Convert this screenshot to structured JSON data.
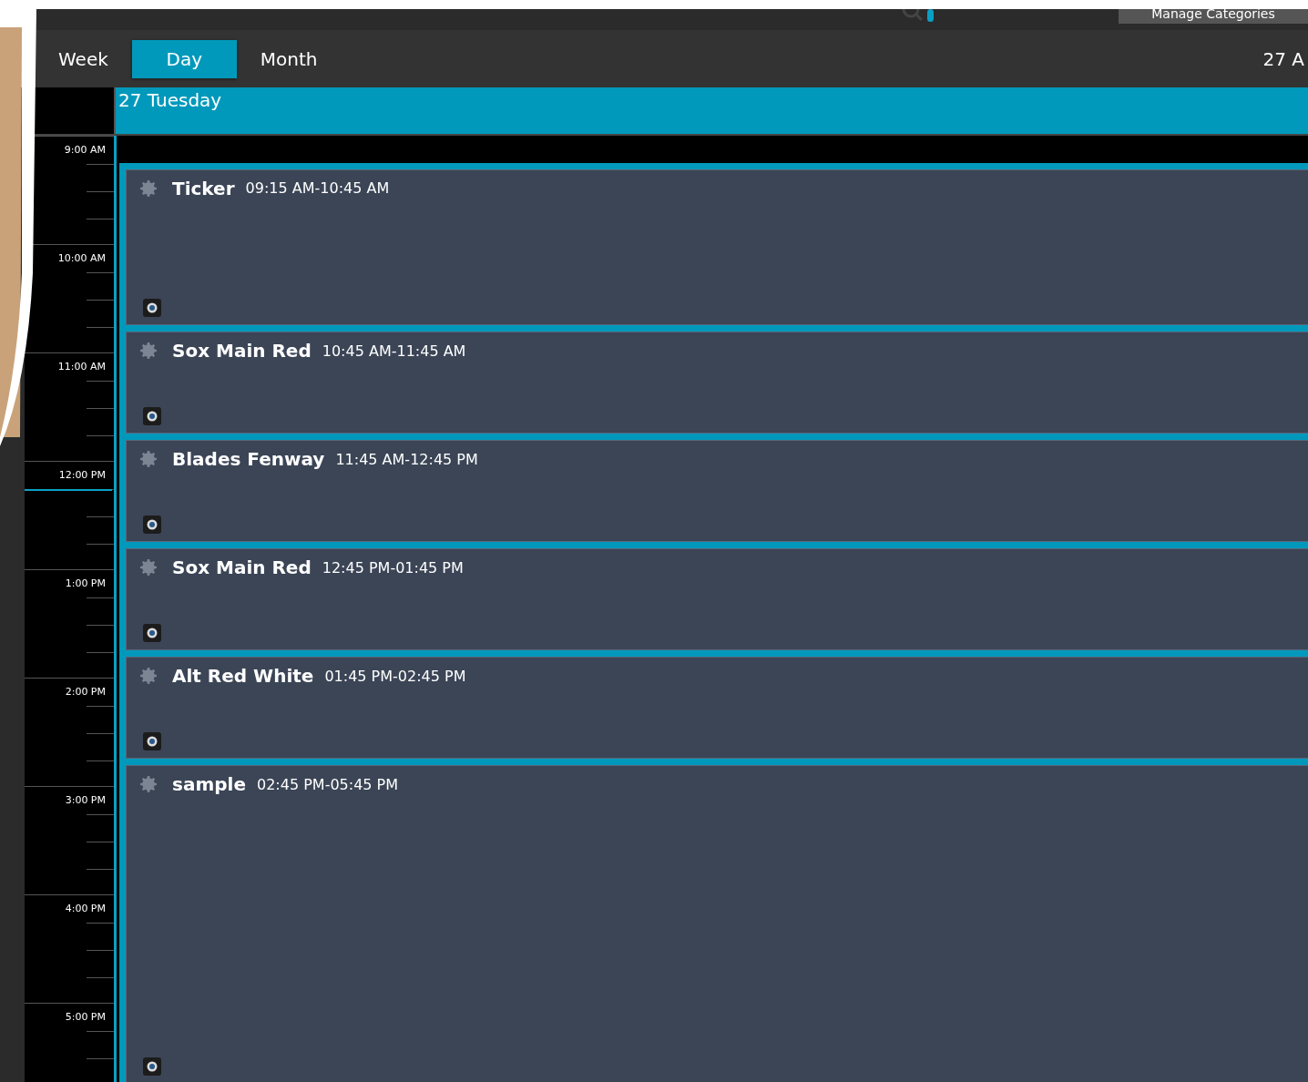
{
  "top_bar": {
    "manage_button": "Manage Categories"
  },
  "view_tabs": [
    {
      "label": "Week",
      "selected": false
    },
    {
      "label": "Day",
      "selected": true
    },
    {
      "label": "Month",
      "selected": false
    }
  ],
  "date_label": "27 A",
  "day_header": "27 Tuesday",
  "time_labels": [
    "9:00 AM",
    "10:00 AM",
    "11:00 AM",
    "12:00 PM",
    "1:00 PM",
    "2:00 PM",
    "3:00 PM",
    "4:00 PM",
    "5:00 PM"
  ],
  "events": [
    {
      "title": "Ticker",
      "time": "09:15 AM-10:45 AM"
    },
    {
      "title": "Sox Main Red",
      "time": "10:45 AM-11:45 AM"
    },
    {
      "title": "Blades Fenway",
      "time": "11:45 AM-12:45 PM"
    },
    {
      "title": "Sox Main Red",
      "time": "12:45 PM-01:45 PM"
    },
    {
      "title": "Alt Red White",
      "time": "01:45 PM-02:45 PM"
    },
    {
      "title": "sample",
      "time": "02:45 PM-05:45 PM"
    }
  ]
}
